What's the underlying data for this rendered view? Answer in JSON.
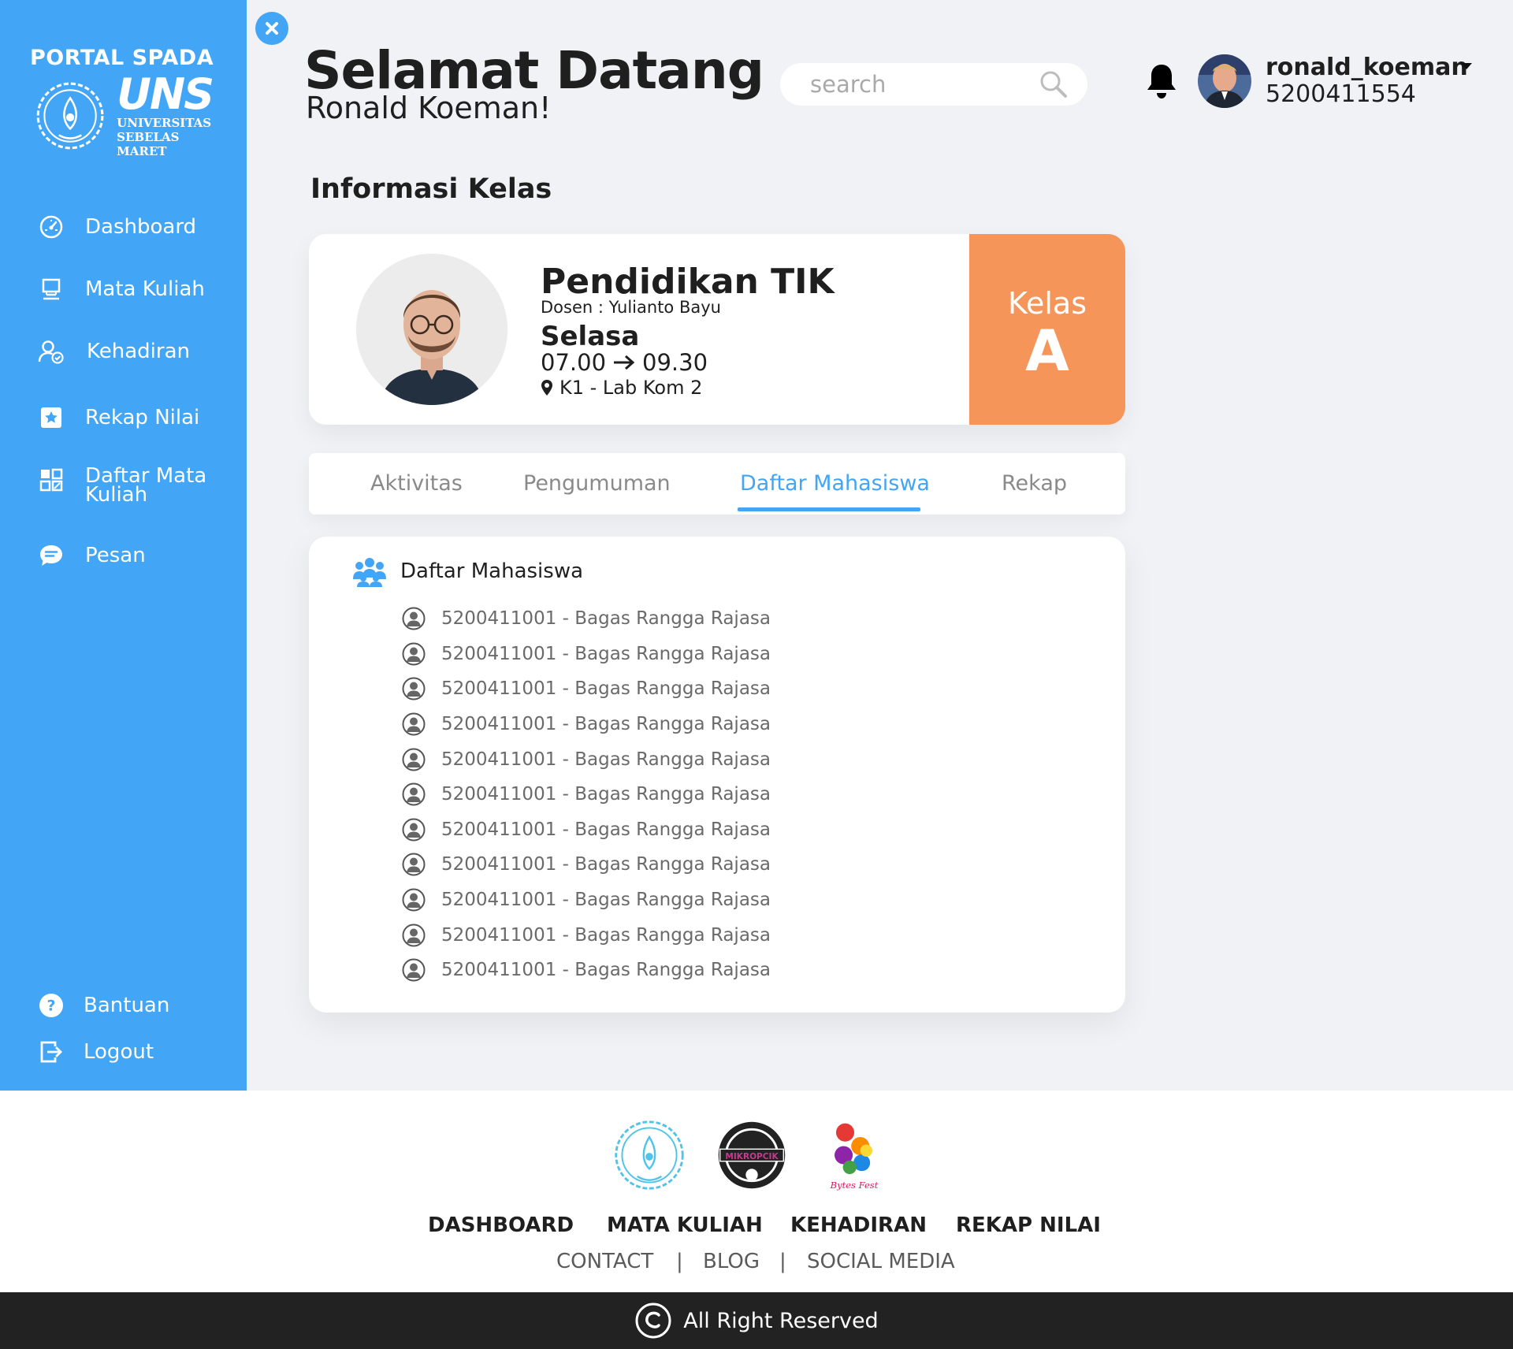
{
  "sidebar": {
    "brand_title": "PORTAL SPADA",
    "logo_text": "UNS",
    "logo_sub1": "UNIVERSITAS",
    "logo_sub2": "SEBELAS MARET",
    "items": [
      {
        "label": "Dashboard",
        "icon": "speedometer-icon"
      },
      {
        "label": "Mata Kuliah",
        "icon": "computer-icon"
      },
      {
        "label": "Kehadiran",
        "icon": "user-check-icon"
      },
      {
        "label": "Rekap Nilai",
        "icon": "star-icon"
      },
      {
        "label": "Daftar Mata Kuliah",
        "icon": "grid-icon"
      },
      {
        "label": "Pesan",
        "icon": "chat-icon"
      }
    ],
    "bottom_items": [
      {
        "label": "Bantuan",
        "icon": "help-icon"
      },
      {
        "label": "Logout",
        "icon": "logout-icon"
      }
    ],
    "color": "#42a5f5"
  },
  "header": {
    "welcome_title": "Selamat Datang",
    "welcome_name": "Ronald Koeman!",
    "search_placeholder": "search",
    "username": "ronald_koeman",
    "user_id": "5200411554"
  },
  "section_title": "Informasi Kelas",
  "class_card": {
    "course_name": "Pendidikan TIK",
    "lecturer": "Dosen : Yulianto Bayu",
    "day": "Selasa",
    "time_start": "07.00",
    "time_end": "09.30",
    "room": "K1 - Lab Kom 2",
    "kelas_label": "Kelas",
    "kelas_letter": "A",
    "kelas_color": "#f5955a"
  },
  "tabs": [
    {
      "label": "Aktivitas",
      "active": false
    },
    {
      "label": "Pengumuman",
      "active": false
    },
    {
      "label": "Daftar Mahasiswa",
      "active": true
    },
    {
      "label": "Rekap",
      "active": false
    }
  ],
  "student_list": {
    "title": "Daftar Mahasiswa",
    "students": [
      "5200411001 - Bagas Rangga Rajasa",
      "5200411001 - Bagas Rangga Rajasa",
      "5200411001 - Bagas Rangga Rajasa",
      "5200411001 - Bagas Rangga Rajasa",
      "5200411001 - Bagas Rangga Rajasa",
      "5200411001 - Bagas Rangga Rajasa",
      "5200411001 - Bagas Rangga Rajasa",
      "5200411001 - Bagas Rangga Rajasa",
      "5200411001 - Bagas Rangga Rajasa",
      "5200411001 - Bagas Rangga Rajasa",
      "5200411001 - Bagas Rangga Rajasa"
    ]
  },
  "footer": {
    "logo_badge_text": "MIKROPCIK",
    "logo_fest_text": "Bytes Fest",
    "nav": [
      "DASHBOARD",
      "MATA KULIAH",
      "KEHADIRAN",
      "REKAP NILAI"
    ],
    "links": [
      "CONTACT",
      "BLOG",
      "SOCIAL MEDIA"
    ],
    "separator": "|",
    "copyright": "All Right Reserved"
  }
}
